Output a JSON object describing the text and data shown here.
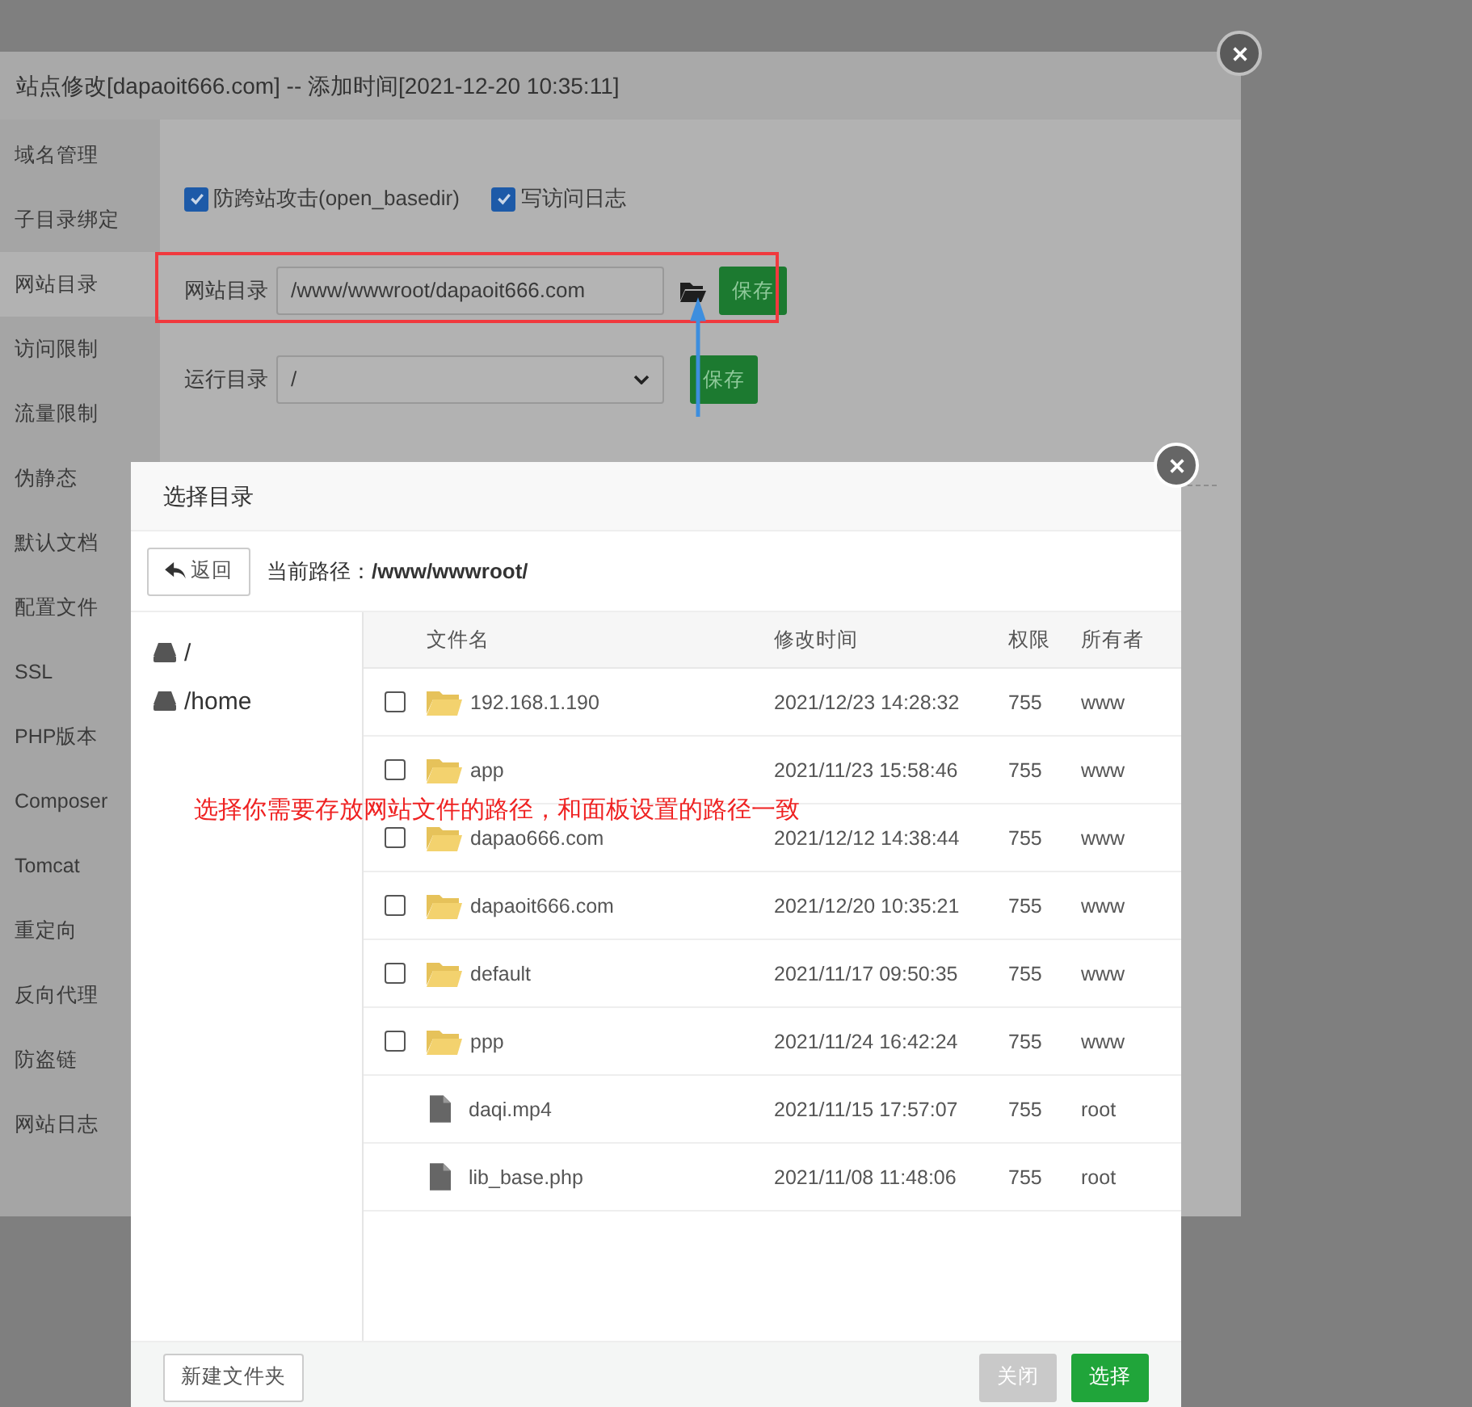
{
  "site_dialog": {
    "title": "站点修改[dapaoit666.com] -- 添加时间[2021-12-20 10:35:11]",
    "sidebar": [
      {
        "label": "域名管理",
        "selected": false
      },
      {
        "label": "子目录绑定",
        "selected": false
      },
      {
        "label": "网站目录",
        "selected": true
      },
      {
        "label": "访问限制",
        "selected": false
      },
      {
        "label": "流量限制",
        "selected": false
      },
      {
        "label": "伪静态",
        "selected": false
      },
      {
        "label": "默认文档",
        "selected": false
      },
      {
        "label": "配置文件",
        "selected": false
      },
      {
        "label": "SSL",
        "selected": false
      },
      {
        "label": "PHP版本",
        "selected": false
      },
      {
        "label": "Composer",
        "selected": false
      },
      {
        "label": "Tomcat",
        "selected": false
      },
      {
        "label": "重定向",
        "selected": false
      },
      {
        "label": "反向代理",
        "selected": false
      },
      {
        "label": "防盗链",
        "selected": false
      },
      {
        "label": "网站日志",
        "selected": false
      }
    ],
    "options": [
      {
        "label": "防跨站攻击(open_basedir)",
        "checked": true
      },
      {
        "label": "写访问日志",
        "checked": true
      }
    ],
    "site_dir": {
      "label": "网站目录",
      "value": "/www/wwwroot/dapaoit666.com",
      "save": "保存"
    },
    "run_dir": {
      "label": "运行目录",
      "value": "/",
      "save": "保存"
    }
  },
  "annotation": "选择你需要存放网站文件的路径，和面板设置的路径一致",
  "picker": {
    "title": "选择目录",
    "back": "返回",
    "path": "当前路径：**/www/wwwroot/**",
    "tree": [
      "/",
      "/home"
    ],
    "columns": [
      "文件名",
      "修改时间",
      "权限",
      "所有者"
    ],
    "rows": [
      {
        "kind": "folder",
        "checked": false,
        "name": "192.168.1.190",
        "time": "2021/12/23 14:28:32",
        "perm": "755",
        "owner": "www"
      },
      {
        "kind": "folder",
        "checked": false,
        "name": "app",
        "time": "2021/11/23 15:58:46",
        "perm": "755",
        "owner": "www"
      },
      {
        "kind": "folder",
        "checked": false,
        "name": "dapao666.com",
        "time": "2021/12/12 14:38:44",
        "perm": "755",
        "owner": "www"
      },
      {
        "kind": "folder",
        "checked": false,
        "name": "dapaoit666.com",
        "time": "2021/12/20 10:35:21",
        "perm": "755",
        "owner": "www"
      },
      {
        "kind": "folder",
        "checked": false,
        "name": "default",
        "time": "2021/11/17 09:50:35",
        "perm": "755",
        "owner": "www"
      },
      {
        "kind": "folder",
        "checked": false,
        "name": "ppp",
        "time": "2021/11/24 16:42:24",
        "perm": "755",
        "owner": "www"
      },
      {
        "kind": "file",
        "name": "daqi.mp4",
        "time": "2021/11/15 17:57:07",
        "perm": "755",
        "owner": "root"
      },
      {
        "kind": "file",
        "name": "lib_base.php",
        "time": "2021/11/08 11:48:06",
        "perm": "755",
        "owner": "root"
      }
    ],
    "new_folder": "新建文件夹",
    "buttons": [
      {
        "label": "关闭",
        "disabled": true
      },
      {
        "label": "选择",
        "disabled": false
      }
    ]
  }
}
